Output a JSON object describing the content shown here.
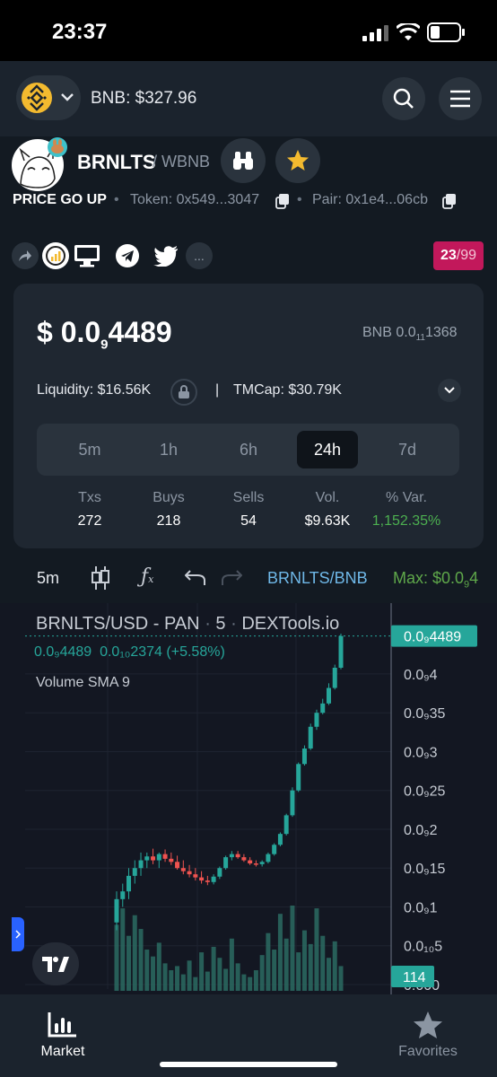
{
  "status_bar": {
    "time": "23:37"
  },
  "header": {
    "network_price": "BNB: $327.96"
  },
  "token": {
    "symbol": "BRNLTS",
    "quote": "/ WBNB",
    "tagline": "PRICE GO UP",
    "token_label": "Token: 0x549...3047",
    "pair_label": "Pair: 0x1e4...06cb",
    "more": "...",
    "rank": "23",
    "rank_total": "/99"
  },
  "price": {
    "usd_prefix": "$ 0.0",
    "usd_sub": "9",
    "usd_tail": "4489",
    "bnb_prefix": "BNB 0.0",
    "bnb_sub": "11",
    "bnb_tail": "1368",
    "liquidity": "Liquidity: $16.56K",
    "separator": "|",
    "tmcap": "TMCap: $30.79K"
  },
  "timeframes": [
    {
      "label": "5m",
      "active": false
    },
    {
      "label": "1h",
      "active": false
    },
    {
      "label": "6h",
      "active": false
    },
    {
      "label": "24h",
      "active": true
    },
    {
      "label": "7d",
      "active": false
    }
  ],
  "stats": [
    {
      "label": "Txs",
      "value": "272"
    },
    {
      "label": "Buys",
      "value": "218"
    },
    {
      "label": "Sells",
      "value": "54"
    },
    {
      "label": "Vol.",
      "value": "$9.63K"
    },
    {
      "label": "% Var.",
      "value": "1,152.35%"
    }
  ],
  "chart_toolbar": {
    "interval": "5m",
    "pair": "BRNLTS/BNB",
    "max_prefix": "Max: $0.0",
    "max_sub": "9",
    "max_tail": "4"
  },
  "chart_data": {
    "type": "candlestick",
    "title": "BRNLTS/USD · PAN · 5 · DEXTools.io",
    "title_parts": {
      "symbol": "BRNLTS/USD - PAN",
      "dot1": "·",
      "interval": "5",
      "dot2": "·",
      "source": "DEXTools.io"
    },
    "ohlc_line": {
      "last": "0.0₉4489",
      "change": "0.0₁₀2374 (+5.58%)"
    },
    "indicator": "Volume SMA 9",
    "y_tick_labels": [
      "0.0₉4",
      "0.0₉35",
      "0.0₉3",
      "0.0₉25",
      "0.0₉2",
      "0.0₉15",
      "0.0₉1",
      "0.0₁₀5",
      "0.000"
    ],
    "y_tick_values": [
      40,
      35,
      30,
      25,
      20,
      15,
      10,
      5,
      0
    ],
    "ylim": [
      0,
      44.5
    ],
    "last_price_label": "0.0₉4489",
    "last_price_value": 44.89,
    "volume_label": "114",
    "candles": [
      [
        8,
        12,
        7,
        11
      ],
      [
        11,
        13,
        10,
        12
      ],
      [
        12,
        15,
        11,
        14
      ],
      [
        14,
        16,
        13,
        15
      ],
      [
        15,
        17,
        14,
        16
      ],
      [
        16,
        17,
        15,
        16.5
      ],
      [
        16.5,
        17.5,
        15.5,
        16
      ],
      [
        16,
        17,
        15,
        16.8
      ],
      [
        16.8,
        17.4,
        15.8,
        16.2
      ],
      [
        16.2,
        17,
        15.4,
        15.8
      ],
      [
        15.8,
        16.6,
        14.8,
        15
      ],
      [
        15,
        16,
        14.2,
        14.6
      ],
      [
        14.6,
        15.4,
        13.8,
        14.2
      ],
      [
        14.2,
        15,
        13.4,
        13.8
      ],
      [
        13.8,
        14.6,
        13,
        13.4
      ],
      [
        13.4,
        14,
        12.8,
        13.2
      ],
      [
        13.2,
        14.2,
        12.9,
        13.9
      ],
      [
        13.9,
        15.2,
        13.6,
        15
      ],
      [
        15,
        16.6,
        14.8,
        16.4
      ],
      [
        16.4,
        17.2,
        16,
        16.8
      ],
      [
        16.8,
        17.2,
        16.2,
        16.4
      ],
      [
        16.4,
        16.8,
        15.8,
        16
      ],
      [
        16,
        16.4,
        15.4,
        15.6
      ],
      [
        15.6,
        16,
        15.2,
        15.5
      ],
      [
        15.5,
        16,
        15.2,
        15.8
      ],
      [
        15.8,
        17,
        15.6,
        16.8
      ],
      [
        16.8,
        18.2,
        16.6,
        18
      ],
      [
        18,
        19.6,
        17.8,
        19.4
      ],
      [
        19.4,
        22,
        19.2,
        21.8
      ],
      [
        21.8,
        25.4,
        21.6,
        25
      ],
      [
        25,
        28.6,
        24.8,
        28.4
      ],
      [
        28.4,
        30.8,
        28.2,
        30.4
      ],
      [
        30.4,
        33.6,
        30.2,
        33.2
      ],
      [
        33.2,
        35.4,
        32.8,
        35
      ],
      [
        35,
        36.8,
        34.8,
        36.2
      ],
      [
        36.2,
        38.8,
        36,
        38.2
      ],
      [
        38.2,
        41.2,
        38,
        40.8
      ],
      [
        40.8,
        45.2,
        40.6,
        44.89
      ]
    ],
    "volumes": [
      48,
      60,
      40,
      55,
      45,
      30,
      25,
      35,
      20,
      15,
      18,
      12,
      22,
      10,
      28,
      14,
      32,
      24,
      16,
      38,
      20,
      12,
      10,
      15,
      26,
      42,
      30,
      56,
      38,
      62,
      28,
      44,
      34,
      60,
      40,
      24,
      36,
      18
    ]
  },
  "bottom_nav": {
    "market": "Market",
    "favorites": "Favorites"
  }
}
